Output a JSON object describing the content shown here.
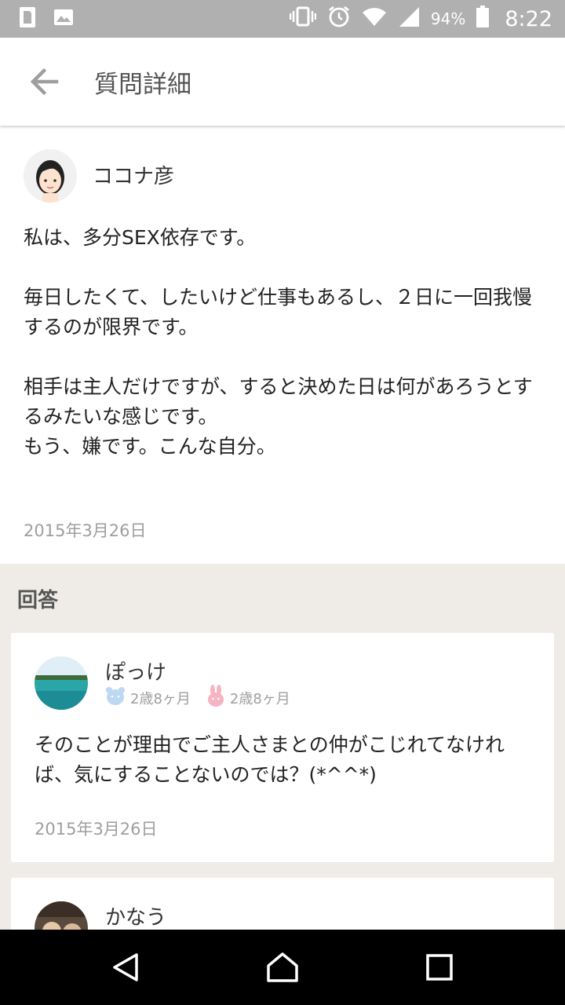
{
  "status": {
    "battery": "94%",
    "time": "8:22"
  },
  "appbar": {
    "title": "質問詳細"
  },
  "question": {
    "author": "ココナ彦",
    "paragraphs": [
      "私は、多分SEX依存です。",
      "毎日したくて、したいけど仕事もあるし、２日に一回我慢するのが限界です。",
      "相手は主人だけですが、すると決めた日は何があろうとするみたいな感じです。\nもう、嫌です。こんな自分。"
    ],
    "date": "2015年3月26日"
  },
  "answers": {
    "heading": "回答",
    "items": [
      {
        "name": "ぽっけ",
        "kids": [
          {
            "icon": "bear-icon",
            "label": "2歳8ヶ月",
            "color": "#bcd8f2"
          },
          {
            "icon": "rabbit-icon",
            "label": "2歳8ヶ月",
            "color": "#f6b3c3"
          }
        ],
        "body": "そのことが理由でご主人さまとの仲がこじれてなければ、気にすることないのでは？(*^^*)",
        "date": "2015年3月26日"
      },
      {
        "name": "かなう"
      }
    ]
  },
  "colors": {
    "statusbar": "#b0b0b0",
    "answers_bg": "#efece8",
    "date_text": "#9e9e9e"
  }
}
